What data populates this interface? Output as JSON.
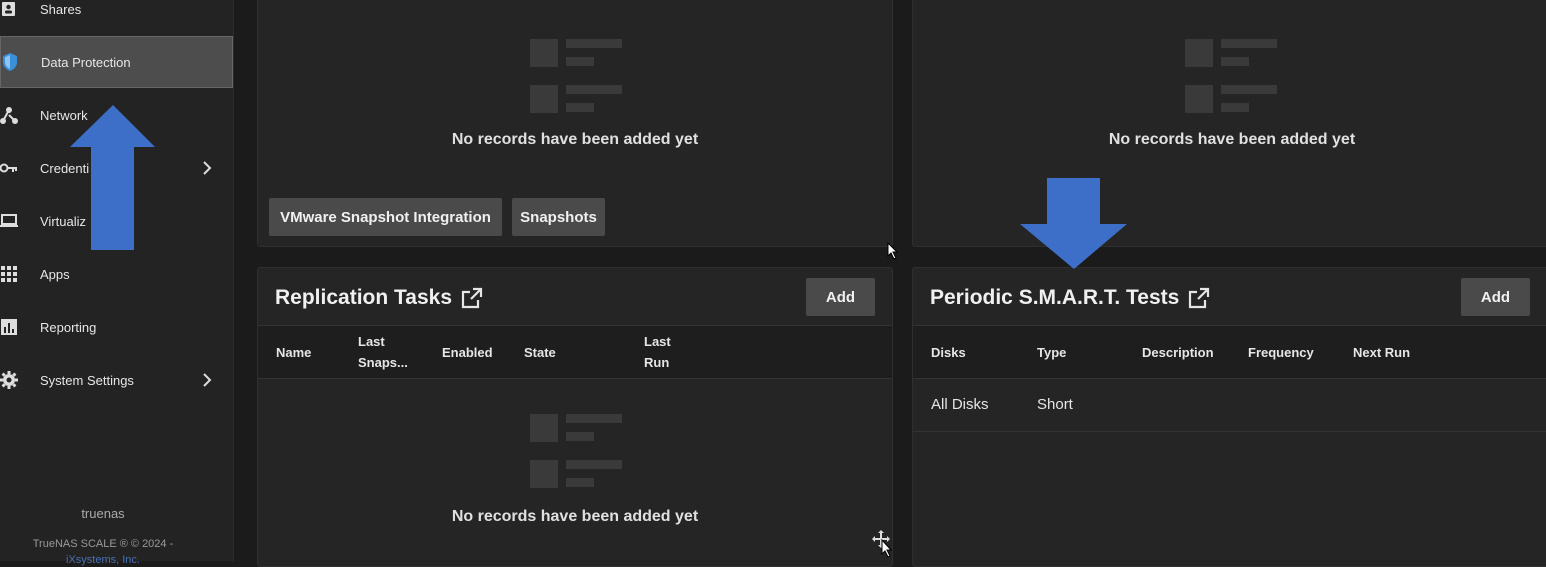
{
  "sidebar": {
    "items": [
      {
        "label": "Shares",
        "icon": "shares-icon"
      },
      {
        "label": "Data Protection",
        "icon": "shield-icon",
        "active": true
      },
      {
        "label": "Network",
        "icon": "network-icon"
      },
      {
        "label": "Credenti",
        "icon": "key-icon",
        "has_submenu": true
      },
      {
        "label": "Virtualiz",
        "icon": "laptop-icon"
      },
      {
        "label": "Apps",
        "icon": "apps-grid-icon"
      },
      {
        "label": "Reporting",
        "icon": "bar-chart-icon"
      },
      {
        "label": "System Settings",
        "icon": "gear-icon",
        "has_submenu": true
      }
    ],
    "hostname": "truenas",
    "copyright": "TrueNAS SCALE ® © 2024 -",
    "company": "iXsystems, Inc."
  },
  "top_left_card": {
    "empty_text": "No records have been added yet",
    "buttons": [
      "VMware Snapshot Integration",
      "Snapshots"
    ]
  },
  "top_right_card": {
    "empty_text": "No records have been added yet"
  },
  "replication": {
    "title": "Replication Tasks",
    "add_label": "Add",
    "columns": [
      "Name",
      "Last Snaps...",
      "Enabled",
      "State",
      "Last Run"
    ],
    "empty_text": "No records have been added yet"
  },
  "smart": {
    "title": "Periodic S.M.A.R.T. Tests",
    "add_label": "Add",
    "columns": [
      "Disks",
      "Type",
      "Description",
      "Frequency",
      "Next Run"
    ],
    "rows": [
      {
        "disks": "All Disks",
        "type": "Short",
        "description": "",
        "frequency": "",
        "next_run": ""
      }
    ]
  },
  "colors": {
    "accent_arrow": "#3e6fc8",
    "active_nav": "#4d4d4d",
    "shield": "#3b8fd8"
  }
}
